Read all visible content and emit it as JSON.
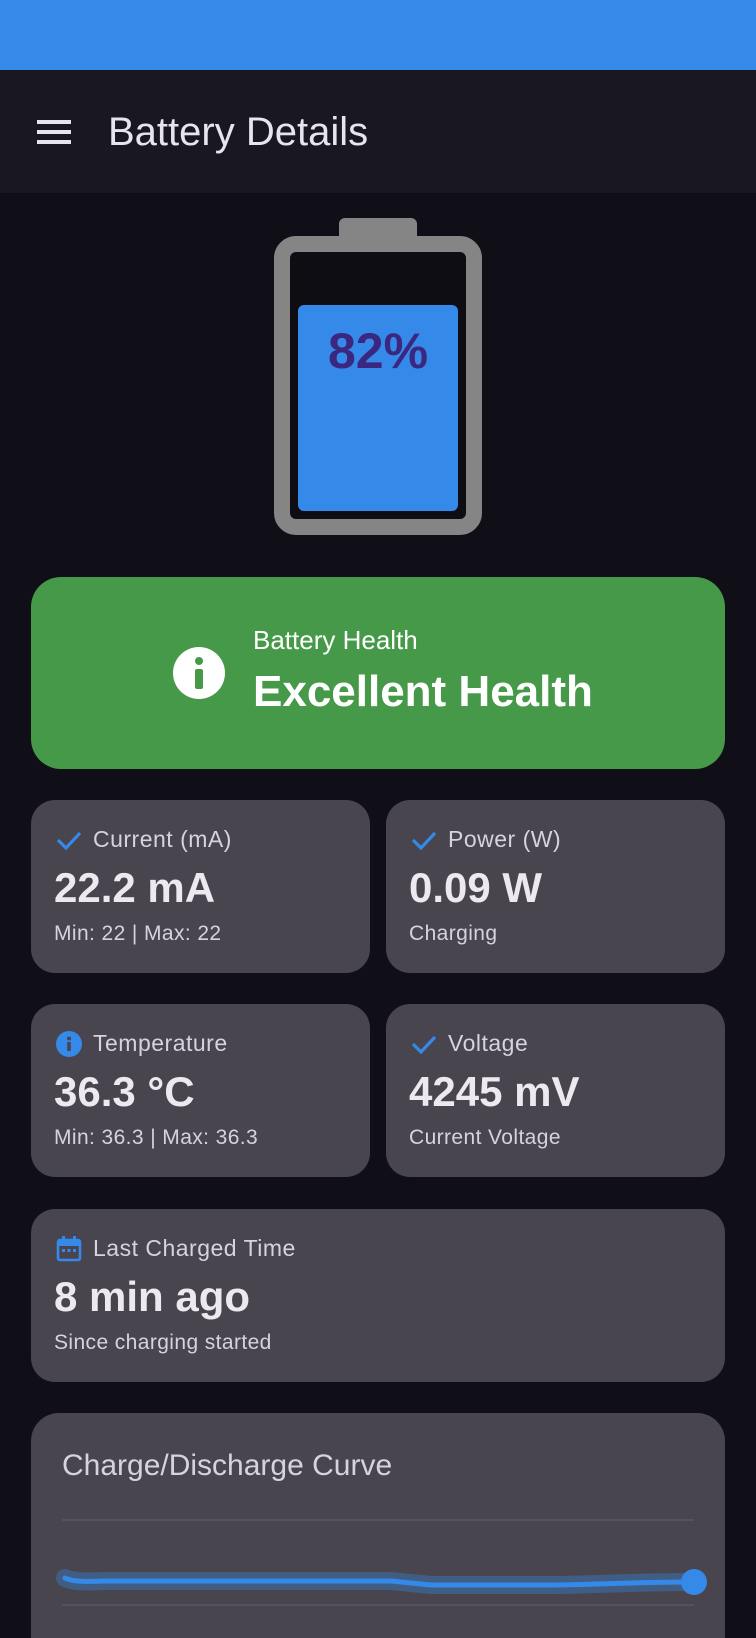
{
  "app_bar": {
    "title": "Battery Details",
    "menu_icon": "menu-icon"
  },
  "battery": {
    "level_percent": 82,
    "label": "82%",
    "fill_color": "#3589e9"
  },
  "health": {
    "label": "Battery Health",
    "value": "Excellent Health",
    "icon": "info-icon",
    "color": "#459948"
  },
  "stats": {
    "current": {
      "icon": "check-icon",
      "label": "Current (mA)",
      "value": "22.2 mA",
      "sub": "Min: 22 | Max: 22"
    },
    "power": {
      "icon": "check-icon",
      "label": "Power (W)",
      "value": "0.09 W",
      "sub": "Charging"
    },
    "temperature": {
      "icon": "info-icon",
      "label": "Temperature",
      "value": "36.3 °C",
      "sub": "Min: 36.3 | Max: 36.3"
    },
    "voltage": {
      "icon": "check-icon",
      "label": "Voltage",
      "value": "4245 mV",
      "sub": "Current Voltage"
    },
    "last_charged": {
      "icon": "calendar-icon",
      "label": "Last Charged Time",
      "value": "8 min ago",
      "sub": "Since charging started"
    }
  },
  "curve": {
    "title": "Charge/Discharge Curve"
  },
  "colors": {
    "accent": "#3589e9",
    "background": "#100f17",
    "card": "#48454f"
  }
}
